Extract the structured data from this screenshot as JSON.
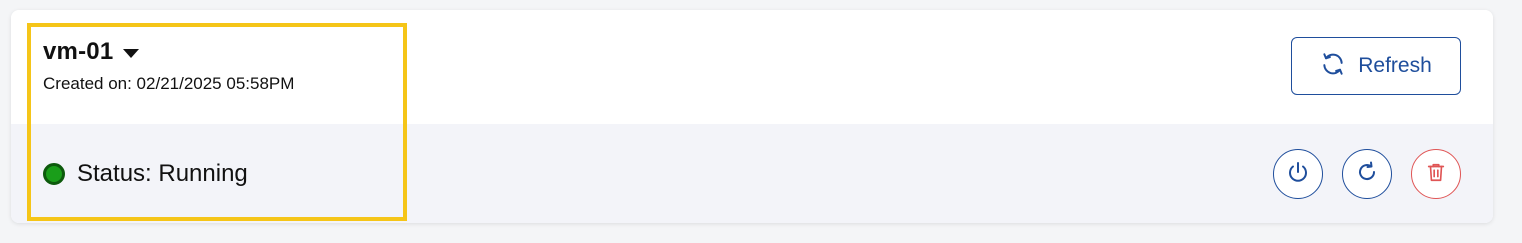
{
  "vm": {
    "name": "vm-01",
    "created": "Created on: 02/21/2025 05:58PM",
    "status_text": "Status: Running",
    "status_color": "#1a9e1a"
  },
  "toolbar": {
    "refresh_label": "Refresh"
  },
  "icons": {
    "refresh": "refresh-icon",
    "caret": "caret-down-icon",
    "power": "power-icon",
    "restart": "restart-icon",
    "delete": "trash-icon"
  },
  "colors": {
    "accent": "#1f4e9c",
    "danger": "#e05555",
    "highlight": "#f5c518",
    "panel_bg": "#f3f4f9"
  }
}
